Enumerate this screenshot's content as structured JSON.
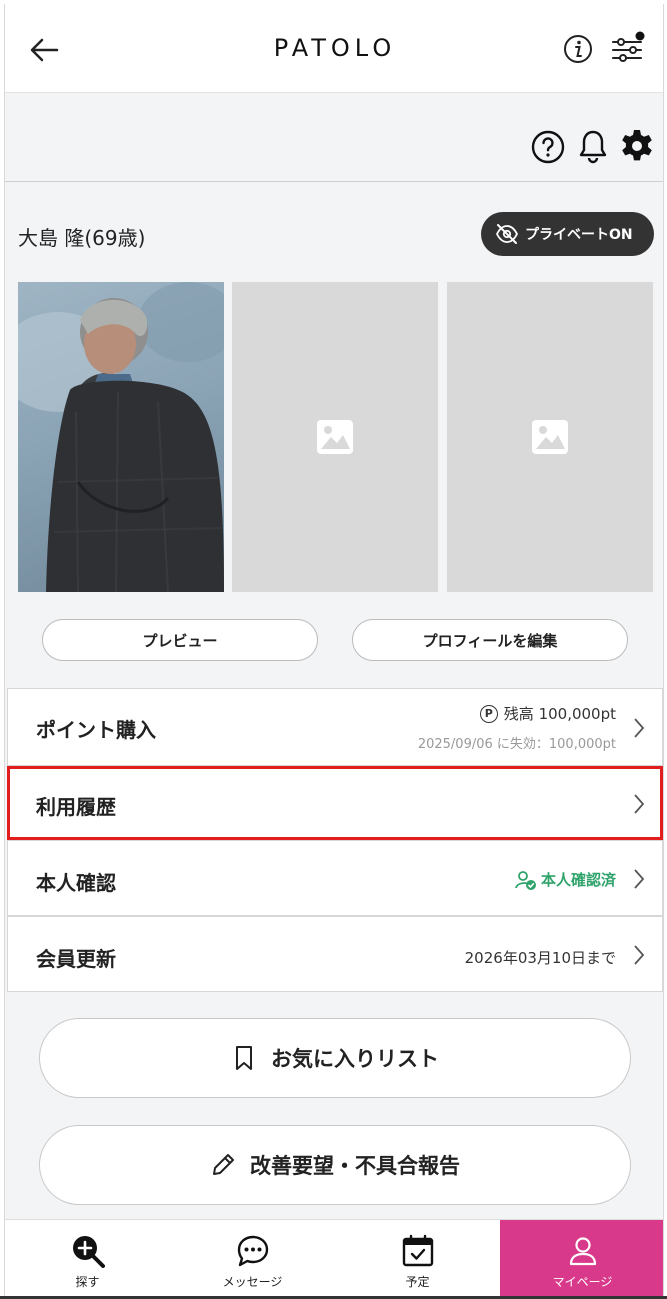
{
  "header": {
    "logo": "PATOLO",
    "back_icon": "arrow-left-icon",
    "info_icon": "info-icon",
    "filter_icon": "filter-sliders-icon"
  },
  "utility": {
    "help_icon": "question-icon",
    "bell_icon": "bell-icon",
    "settings_icon": "gear-icon"
  },
  "profile": {
    "name": "大島 隆(69歳)",
    "private_label": "プライベートON"
  },
  "actions": {
    "preview": "プレビュー",
    "edit": "プロフィールを編集"
  },
  "menu": {
    "points": {
      "label": "ポイント購入",
      "balance_icon": "Ⓟ",
      "balance": "残高 100,000pt",
      "expiry": "2025/09/06 に失効：100,000pt"
    },
    "history": {
      "label": "利用履歴"
    },
    "verify": {
      "label": "本人確認",
      "status": "本人確認済"
    },
    "renew": {
      "label": "会員更新",
      "date": "2026年03月10日まで"
    }
  },
  "buttons": {
    "favorites": "お気に入りリスト",
    "report": "改善要望・不具合報告"
  },
  "tabs": [
    {
      "label": "探す",
      "icon": "search-zoom-icon"
    },
    {
      "label": "メッセージ",
      "icon": "chat-bubble-icon"
    },
    {
      "label": "予定",
      "icon": "calendar-check-icon"
    },
    {
      "label": "マイページ",
      "icon": "person-icon"
    }
  ],
  "colors": {
    "accent_pink": "#d9398a",
    "verified_green": "#2fa36b",
    "highlight_red": "#e11d1d",
    "dark_button": "#333333"
  }
}
